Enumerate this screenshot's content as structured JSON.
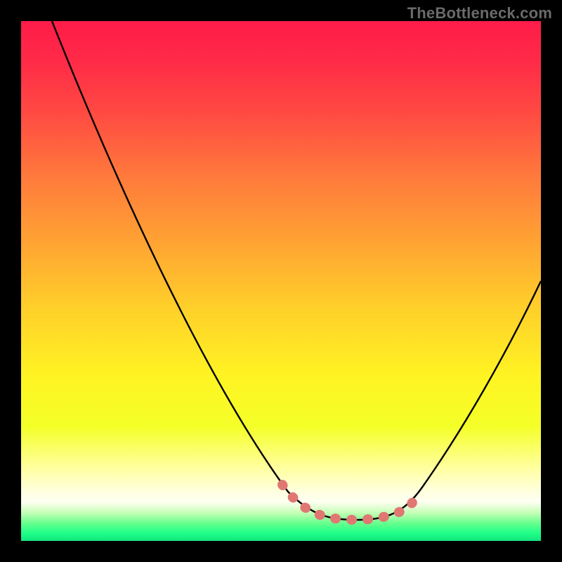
{
  "watermark": "TheBottleneck.com",
  "colors": {
    "gradient_top": "#ff1c49",
    "gradient_mid": "#fff323",
    "gradient_bottom": "#13e57e",
    "curve_stroke": "#000000",
    "highlight_stroke": "#e07772",
    "frame_background": "#000000"
  },
  "chart_data": {
    "type": "line",
    "title": "",
    "xlabel": "",
    "ylabel": "",
    "xlim": [
      0,
      100
    ],
    "ylim": [
      0,
      100
    ],
    "series": [
      {
        "name": "bottleneck-curve",
        "x": [
          5,
          15,
          25,
          35,
          45,
          52,
          58,
          63,
          67,
          72,
          78,
          85,
          92,
          100
        ],
        "values": [
          102,
          80,
          60,
          42,
          26,
          15,
          8,
          4,
          3,
          5,
          12,
          25,
          38,
          50
        ]
      }
    ],
    "annotations": [
      {
        "name": "optimal-region",
        "style": "dotted-pink",
        "x_range": [
          50,
          77
        ],
        "y_range": [
          3,
          11
        ]
      }
    ],
    "legend": false,
    "grid": false
  }
}
